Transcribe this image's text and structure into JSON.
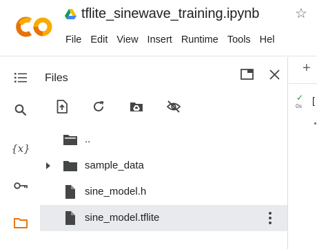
{
  "app": {
    "logo_text": "CO",
    "notebook_title": "tflite_sinewave_training.ipynb",
    "icons": {
      "drive": "google-drive-icon",
      "star": "star-outline-icon"
    },
    "colors": {
      "logo_orange": "#F9AB00",
      "logo_dark_orange": "#E8710A",
      "folder": "#444746",
      "selected_row": "#e8eaed",
      "accent_orange": "#E8710A"
    }
  },
  "menu": {
    "items": [
      {
        "label": "File"
      },
      {
        "label": "Edit"
      },
      {
        "label": "View"
      },
      {
        "label": "Insert"
      },
      {
        "label": "Runtime"
      },
      {
        "label": "Tools"
      },
      {
        "label": "Hel"
      }
    ]
  },
  "rail": {
    "items": [
      {
        "name": "table-of-contents-icon"
      },
      {
        "name": "search-icon"
      },
      {
        "name": "variables-icon",
        "text": "{x}"
      },
      {
        "name": "secrets-key-icon"
      },
      {
        "name": "files-folder-icon",
        "active": true
      }
    ]
  },
  "files_panel": {
    "title": "Files",
    "actions": [
      "open-in-tab-icon",
      "close-icon"
    ],
    "toolbar": [
      "upload-file-icon",
      "refresh-icon",
      "mount-drive-icon",
      "hide-files-icon"
    ],
    "entries": [
      {
        "label": "..",
        "type": "folder",
        "expandable": false
      },
      {
        "label": "sample_data",
        "type": "folder",
        "expandable": true
      },
      {
        "label": "sine_model.h",
        "type": "file",
        "expandable": false
      },
      {
        "label": "sine_model.tflite",
        "type": "file",
        "expandable": false,
        "selected": true
      }
    ]
  },
  "notebook": {
    "add_cell_label": "+",
    "cell": {
      "status_icon": "check-icon",
      "status_check": "✓",
      "exec_time": "0s",
      "bracket": "["
    }
  }
}
